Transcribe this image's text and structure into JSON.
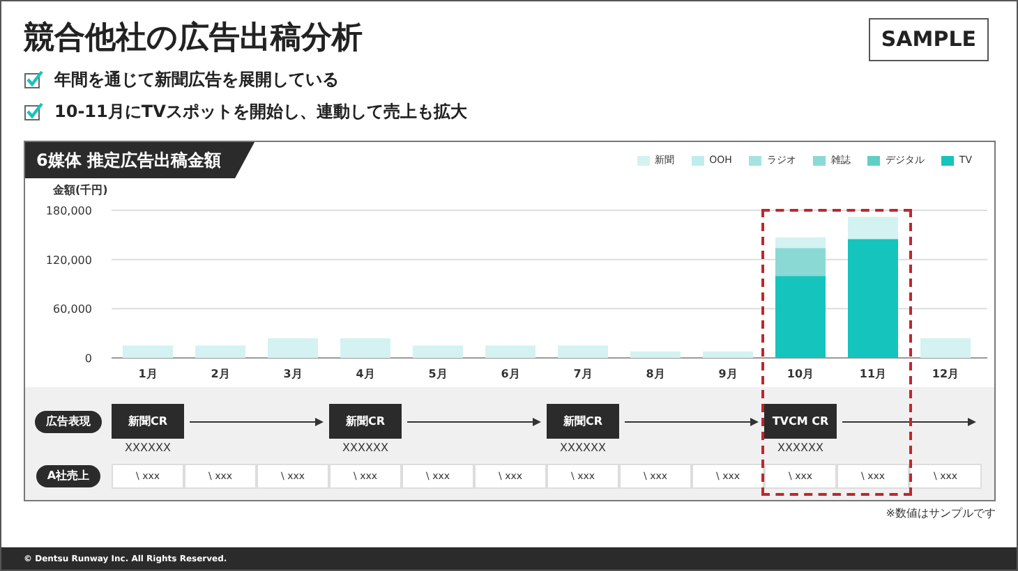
{
  "title": "競合他社の広告出稿分析",
  "badge": "SAMPLE",
  "points": [
    {
      "text": "年間を通じて新聞広告を展開している",
      "checked": true
    },
    {
      "text": "10-11月にTVスポットを開始し、連動して売上も拡大",
      "checked": true
    }
  ],
  "panel": {
    "title": "6媒体 推定広告出稿金額",
    "chart_data": {
      "type": "bar",
      "stacked": true,
      "ylabel": "金額(千円)",
      "categories": [
        "1月",
        "2月",
        "3月",
        "4月",
        "5月",
        "6月",
        "7月",
        "8月",
        "9月",
        "10月",
        "11月",
        "12月"
      ],
      "ylim": [
        0,
        180000
      ],
      "yticks": [
        {
          "value": 0,
          "label": "0"
        },
        {
          "value": 60000,
          "label": "60,000"
        },
        {
          "value": 120000,
          "label": "120,000"
        },
        {
          "value": 180000,
          "label": "180,000"
        }
      ],
      "series": [
        {
          "name": "新聞",
          "color": "#d3f2f1",
          "values": [
            15000,
            15000,
            24000,
            24000,
            15000,
            15000,
            15000,
            8000,
            8000,
            13000,
            27000,
            24000
          ]
        },
        {
          "name": "OOH",
          "color": "#bdeeeb",
          "values": [
            0,
            0,
            0,
            0,
            0,
            0,
            0,
            0,
            0,
            0,
            0,
            0
          ]
        },
        {
          "name": "ラジオ",
          "color": "#a3e4e0",
          "values": [
            0,
            0,
            0,
            0,
            0,
            0,
            0,
            0,
            0,
            0,
            0,
            0
          ]
        },
        {
          "name": "雑誌",
          "color": "#8ad9d4",
          "values": [
            0,
            0,
            0,
            0,
            0,
            0,
            0,
            0,
            0,
            34000,
            0,
            0
          ]
        },
        {
          "name": "デジタル",
          "color": "#5fcfc6",
          "values": [
            0,
            0,
            0,
            0,
            0,
            0,
            0,
            0,
            0,
            0,
            0,
            0
          ]
        },
        {
          "name": "TV",
          "color": "#14c4bd",
          "values": [
            0,
            0,
            0,
            0,
            0,
            0,
            0,
            0,
            0,
            100000,
            145000,
            0
          ]
        }
      ]
    },
    "creative_label": "広告表現",
    "creatives": [
      {
        "kind": "block",
        "label": "新聞CR",
        "caption": "XXXXXX"
      },
      {
        "kind": "arrow"
      },
      {
        "kind": "arrow"
      },
      {
        "kind": "block",
        "label": "新聞CR",
        "caption": "XXXXXX"
      },
      {
        "kind": "arrow"
      },
      {
        "kind": "arrow"
      },
      {
        "kind": "block",
        "label": "新聞CR",
        "caption": "XXXXXX"
      },
      {
        "kind": "arrow"
      },
      {
        "kind": "arrow"
      },
      {
        "kind": "block",
        "label": "TVCM CR",
        "caption": "XXXXXX"
      },
      {
        "kind": "arrow"
      },
      {
        "kind": "arrow"
      }
    ],
    "sales_label": "A社売上",
    "sales": [
      "\\ xxx",
      "\\ xxx",
      "\\ xxx",
      "\\ xxx",
      "\\ xxx",
      "\\ xxx",
      "\\ xxx",
      "\\ xxx",
      "\\ xxx",
      "\\ xxx",
      "\\ xxx",
      "\\ xxx"
    ]
  },
  "note": "※数値はサンプルです",
  "footer": "© Dentsu Runway Inc. All Rights Reserved."
}
